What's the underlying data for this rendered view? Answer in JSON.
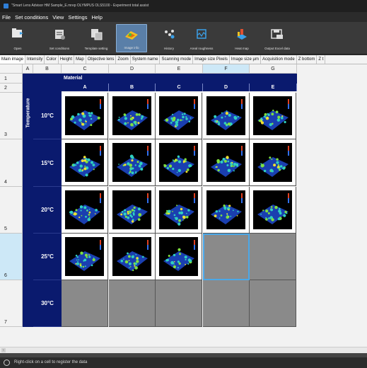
{
  "window": {
    "title": "\"Smart Lens Advisor HM Sample_E.mrep OLYMPUS OLS5100 - Experiment total assist"
  },
  "menu": [
    "File",
    "Set conditions",
    "View",
    "Settings",
    "Help"
  ],
  "toolbar": [
    {
      "label": "Open",
      "icon": "folder-open-icon"
    },
    {
      "label": "Set conditions",
      "icon": "set-conditions-icon"
    },
    {
      "label": "Template setting",
      "icon": "template-icon"
    },
    {
      "label": "Image info",
      "icon": "image-info-icon",
      "active": true
    },
    {
      "label": "History",
      "icon": "history-icon"
    },
    {
      "label": "Areal roughness",
      "icon": "areal-roughness-icon"
    },
    {
      "label": "Heat map",
      "icon": "heat-map-icon"
    },
    {
      "label": "Output Excel data",
      "icon": "excel-output-icon"
    }
  ],
  "tabs": [
    "Main image",
    "Intensity",
    "Color",
    "Height",
    "Map",
    "Objective lens",
    "Zoom",
    "System name",
    "Scanning mode",
    "Image size Pixels",
    "Image size µm",
    "Acquisition mode",
    "Z bottom",
    "Z t"
  ],
  "sheet": {
    "col_headers": [
      "A",
      "B",
      "C",
      "D",
      "E",
      "F",
      "G"
    ],
    "row_headers": [
      "1",
      "2",
      "3",
      "4",
      "5",
      "6",
      "7"
    ],
    "material_label": "Material",
    "material_cols": [
      "A",
      "B",
      "C",
      "D",
      "E"
    ],
    "temperature_label": "Temperature",
    "temperatures": [
      "10°C",
      "15°C",
      "20°C",
      "25°C",
      "30°C"
    ],
    "image_counts": [
      5,
      5,
      5,
      3,
      0
    ]
  },
  "status": {
    "text": "Right-click on a cell to register the data"
  },
  "colors": {
    "navy": "#0a1a6e",
    "empty_cell": "#8a8a8a",
    "selected": "#4aa8e8"
  }
}
